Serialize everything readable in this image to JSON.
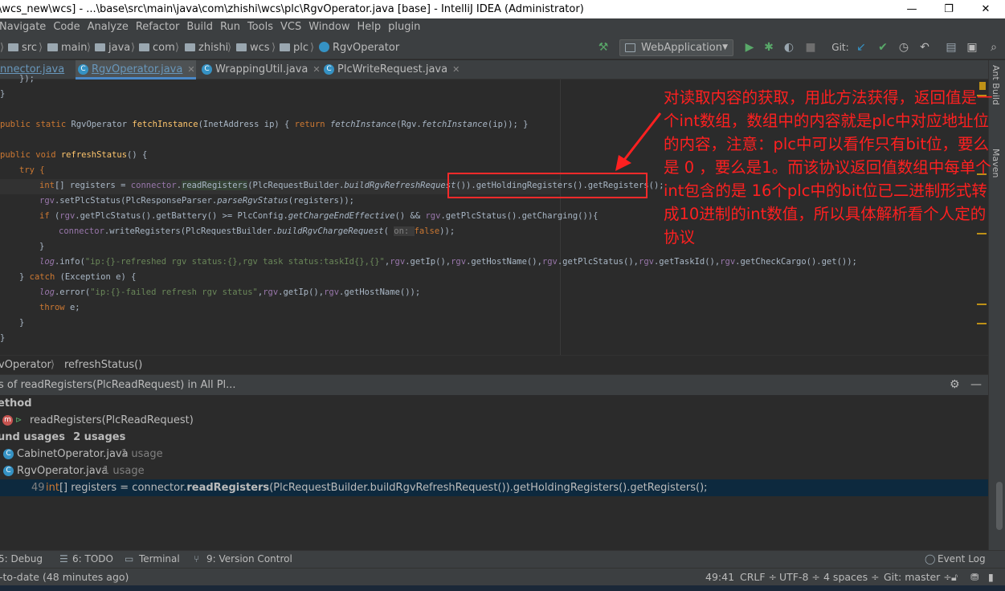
{
  "window": {
    "title": "\\wcs_new\\wcs] - ...\\base\\src\\main\\java\\com\\zhishi\\wcs\\plc\\RgvOperator.java [base] - IntelliJ IDEA (Administrator)",
    "minimize": "—",
    "maximize": "❐",
    "close": "✕"
  },
  "menu": [
    "Navigate",
    "Code",
    "Analyze",
    "Refactor",
    "Build",
    "Run",
    "Tools",
    "VCS",
    "Window",
    "Help",
    "plugin"
  ],
  "breadcrumbs": [
    "src",
    "main",
    "java",
    "com",
    "zhishi",
    "wcs",
    "plc",
    "RgvOperator"
  ],
  "toolbar": {
    "run_config": "WebApplication",
    "git_label": "Git:"
  },
  "tabs": [
    {
      "label": "nnector.java"
    },
    {
      "label": "RgvOperator.java",
      "active": true
    },
    {
      "label": "WrappingUtil.java"
    },
    {
      "label": "PlcWriteRequest.java"
    }
  ],
  "right_strip": {
    "ant": "Ant Build",
    "maven": "Maven"
  },
  "code": {
    "l0": "});",
    "l1": "}",
    "l3a": "public static ",
    "l3b": "RgvOperator ",
    "l3c": "fetchInstance",
    "l3d": "(InetAddress ip) { ",
    "l3e": "return ",
    "l3f": "fetchInstance",
    "l3g": "(Rgv.",
    "l3h": "fetchInstance",
    "l3i": "(ip)); }",
    "l5a": "public void ",
    "l5b": "refreshStatus",
    "l5c": "() {",
    "l6": "try {",
    "l7a": "int",
    "l7b": "[] registers = ",
    "l7c": "connector",
    "l7d": ".",
    "l7e": "readRegisters",
    "l7f": "(PlcRequestBuilder.",
    "l7g": "buildRgvRefreshRequest",
    "l7h": "()).getHoldingRegisters().getRegisters();",
    "l8a": "rgv",
    "l8b": ".setPlcStatus(PlcResponseParser.",
    "l8c": "parseRgvStatus",
    "l8d": "(registers));",
    "l9a": "if ",
    "l9b": "(",
    "l9c": "rgv",
    "l9d": ".getPlcStatus().getBattery() >= PlcConfig.",
    "l9e": "getChargeEndEffective",
    "l9f": "() && ",
    "l9g": "rgv",
    "l9h": ".getPlcStatus().getCharging()){",
    "l10a": "connector",
    "l10b": ".writeRegisters(PlcRequestBuilder.",
    "l10c": "buildRgvChargeRequest",
    "l10d": "( ",
    "l10e": "on: ",
    "l10f": "false",
    "l10g": "));",
    "l11": "}",
    "l12a": "log",
    "l12b": ".info(",
    "l12c": "\"ip:{}-refreshed rgv status:{},rgv task status:taskId{},{}\"",
    "l12d": ",",
    "l12e": "rgv",
    "l12f": ".getIp(),",
    "l12g": "rgv",
    "l12h": ".getHostName(),",
    "l12i": "rgv",
    "l12j": ".getPlcStatus(),",
    "l12k": "rgv",
    "l12l": ".getTaskId(),",
    "l12m": "rgv",
    "l12n": ".getCheckCargo().get());",
    "l13a": "} ",
    "l13b": "catch ",
    "l13c": "(Exception e) {",
    "l14a": "log",
    "l14b": ".error(",
    "l14c": "\"ip:{}-failed refresh rgv status\"",
    "l14d": ",",
    "l14e": "rgv",
    "l14f": ".getIp(),",
    "l14g": "rgv",
    "l14h": ".getHostName());",
    "l15a": "throw ",
    "l15b": "e;",
    "l16": "}",
    "l17": "}"
  },
  "annotation": "对读取内容的获取，用此方法获得，返回值是一个int数组，数组中的内容就是plc中对应地址位的内容，注意：plc中可以看作只有bit位，要么是 0 ，要么是1。而该协议返回值数组中每单个int包含的是 16个plc中的bit位已二进制形式转成10进制的int数值，所以具体解析看个人定的协议",
  "editor_breadcrumb": {
    "a": "vOperator",
    "b": "refreshStatus()"
  },
  "find_panel": {
    "header": "s of readRegisters(PlcReadRequest) in All Pl...",
    "method_label": "ethod",
    "method_item": "readRegisters(PlcReadRequest)",
    "found_label": "und usages",
    "found_count": "2 usages",
    "files": [
      {
        "name": "CabinetOperator.java",
        "count": "1 usage"
      },
      {
        "name": "RgvOperator.java",
        "count": "1 usage"
      }
    ],
    "usage_line": "49",
    "usage_a": "int",
    "usage_b": "[] registers = connector.",
    "usage_c": "readRegisters",
    "usage_d": "(PlcRequestBuilder.buildRgvRefreshRequest()).getHoldingRegisters().getRegisters();"
  },
  "bottom_tools": [
    "5: Debug",
    "6: TODO",
    "Terminal",
    "9: Version Control",
    "Event Log"
  ],
  "status": {
    "left": "-to-date (48 minutes ago)",
    "pos": "49:41",
    "crlf": "CRLF ÷",
    "enc": "UTF-8 ÷",
    "indent": "4 spaces ÷",
    "git": "Git: master ÷"
  }
}
